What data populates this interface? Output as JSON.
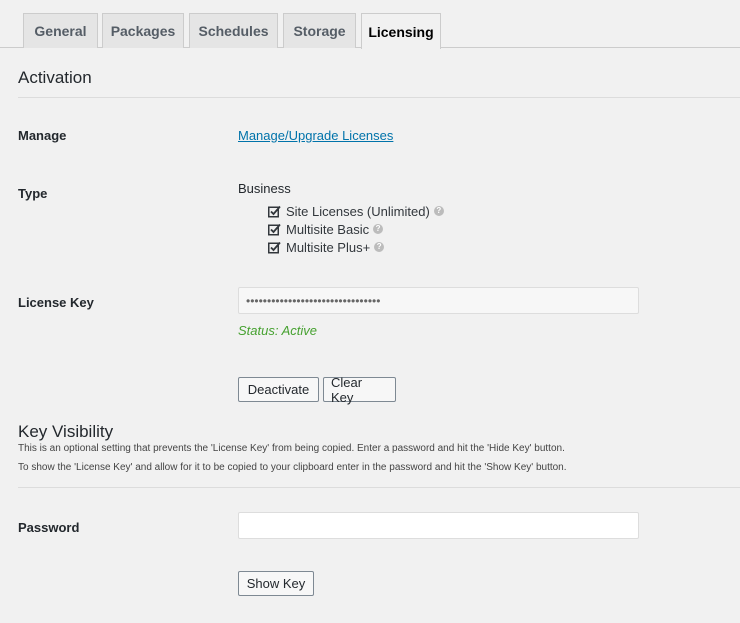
{
  "tabs": [
    {
      "label": "General",
      "active": false
    },
    {
      "label": "Packages",
      "active": false
    },
    {
      "label": "Schedules",
      "active": false
    },
    {
      "label": "Storage",
      "active": false
    },
    {
      "label": "Licensing",
      "active": true
    }
  ],
  "activation": {
    "heading": "Activation",
    "manage_label": "Manage",
    "manage_link": "Manage/Upgrade Licenses",
    "type_label": "Type",
    "type_value": "Business",
    "features": [
      {
        "label": "Site Licenses (Unlimited)",
        "checked": true,
        "icon": "help-icon"
      },
      {
        "label": "Multisite Basic",
        "checked": true,
        "icon": "help-icon"
      },
      {
        "label": "Multisite Plus+",
        "checked": true,
        "icon": "help-icon"
      }
    ],
    "license_key_label": "License Key",
    "license_key_value": "••••••••••••••••••••••••••••••••",
    "status_text": "Status: Active",
    "deactivate_label": "Deactivate",
    "clear_key_label": "Clear Key"
  },
  "key_visibility": {
    "heading": "Key Visibility",
    "description_line1": "This is an optional setting that prevents the 'License Key' from being copied. Enter a password and hit the 'Hide Key' button.",
    "description_line2": "To show the 'License Key' and allow for it to be copied to your clipboard enter in the password and hit the 'Show Key' button.",
    "password_label": "Password",
    "password_value": "",
    "show_key_label": "Show Key"
  },
  "colors": {
    "link": "#0073aa",
    "status_active": "#46a130",
    "background": "#f1f1f1"
  }
}
